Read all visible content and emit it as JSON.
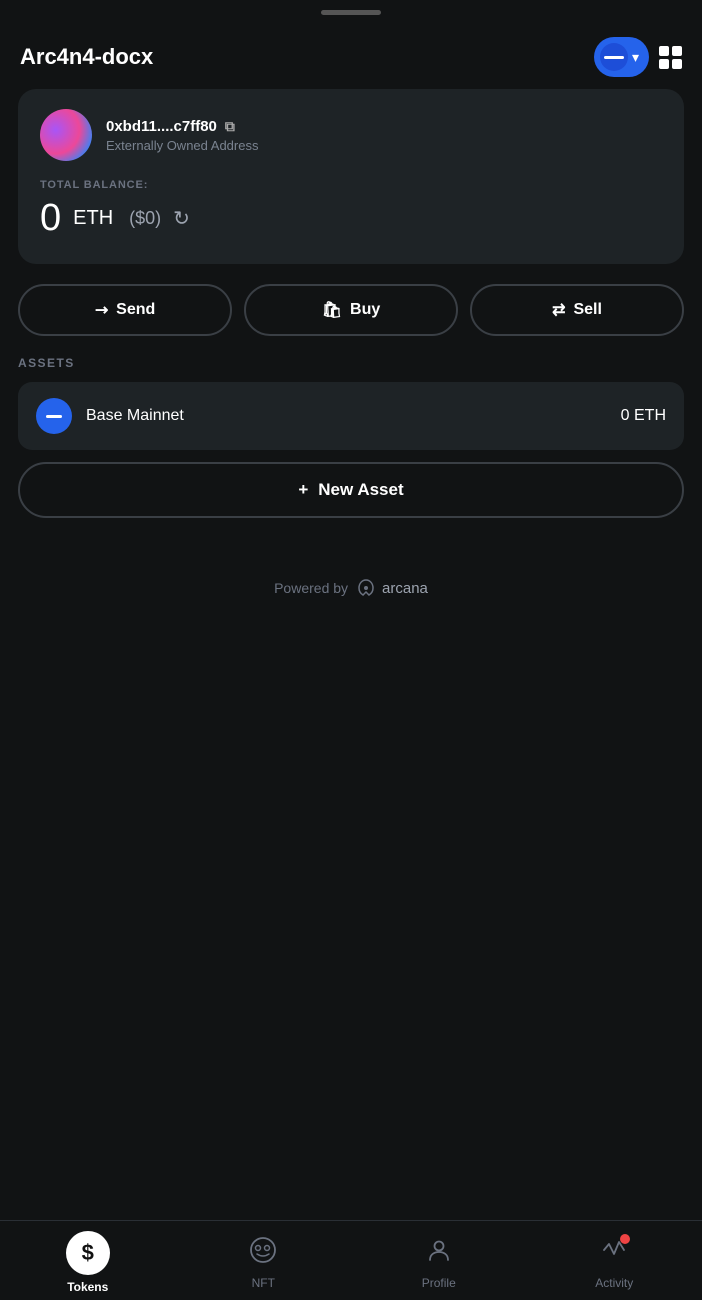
{
  "app": {
    "title": "Arc4n4-docx"
  },
  "header": {
    "title": "Arc4n4-docx",
    "account_icon": "minus",
    "chevron": "▾",
    "qr_label": "QR Code"
  },
  "wallet": {
    "address": "0xbd11....c7ff80",
    "address_type": "Externally Owned Address",
    "balance_label": "TOTAL BALANCE:",
    "balance_amount": "0",
    "balance_unit": "ETH",
    "balance_usd": "($0)",
    "refresh_label": "refresh"
  },
  "actions": {
    "send_label": "Send",
    "buy_label": "Buy",
    "sell_label": "Sell"
  },
  "assets": {
    "section_label": "ASSETS",
    "items": [
      {
        "name": "Base Mainnet",
        "balance": "0 ETH"
      }
    ],
    "new_asset_label": "New Asset",
    "new_asset_prefix": "+"
  },
  "footer": {
    "powered_by": "Powered by",
    "brand": "arcana"
  },
  "nav": {
    "items": [
      {
        "label": "Tokens",
        "icon": "dollar",
        "active": true
      },
      {
        "label": "NFT",
        "icon": "nft",
        "active": false
      },
      {
        "label": "Profile",
        "icon": "profile",
        "active": false
      },
      {
        "label": "Activity",
        "icon": "activity",
        "active": false,
        "badge": true
      }
    ]
  }
}
